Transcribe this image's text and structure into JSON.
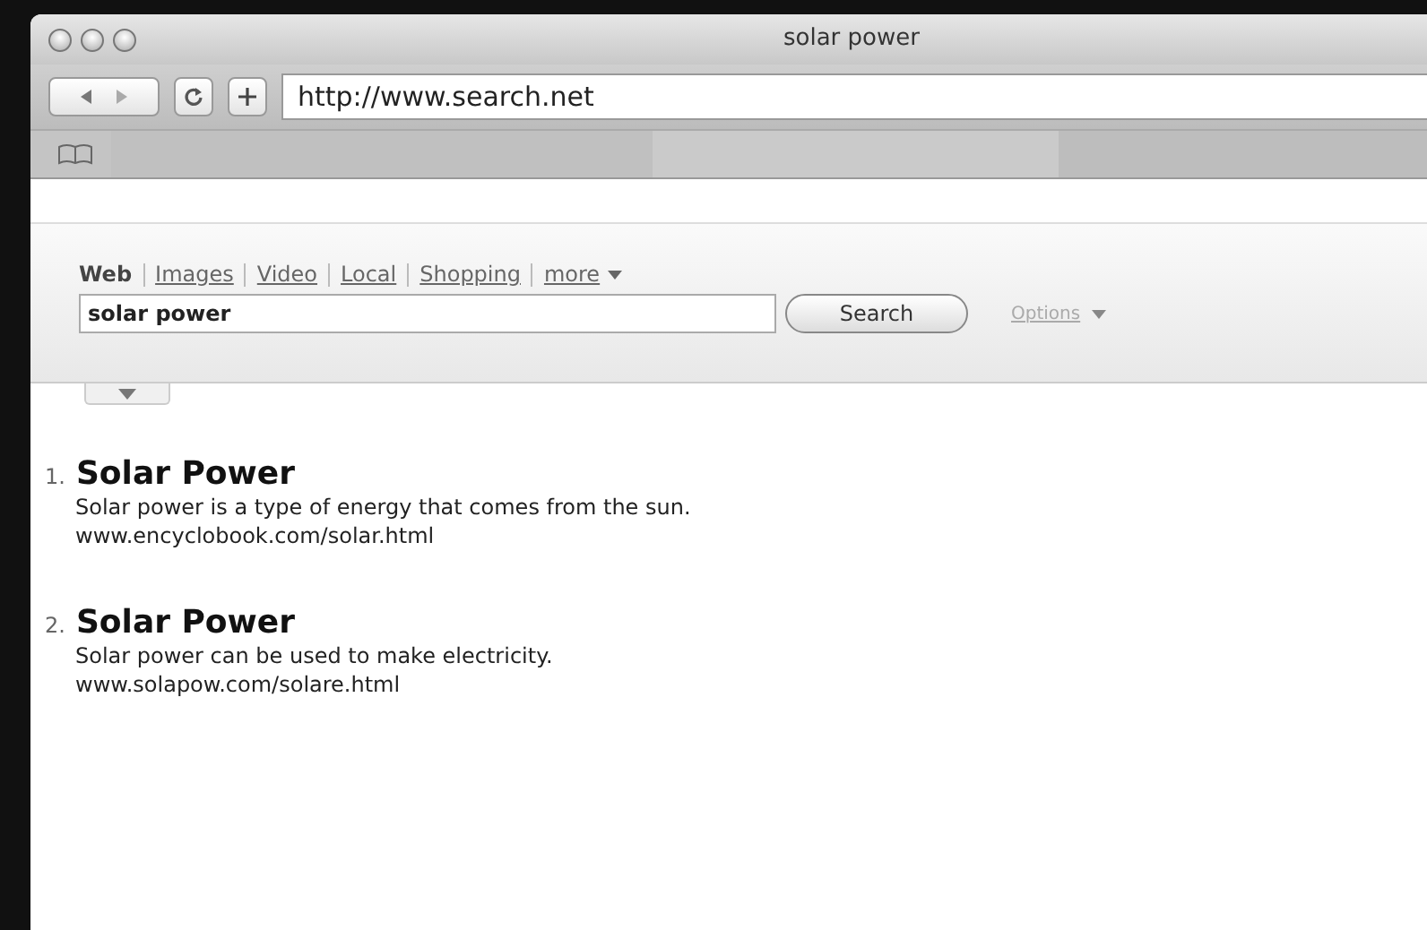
{
  "window": {
    "title": "solar power"
  },
  "toolbar": {
    "address": "http://www.search.net"
  },
  "search_tabs": [
    {
      "label": "Web",
      "selected": true
    },
    {
      "label": "Images",
      "selected": false
    },
    {
      "label": "Video",
      "selected": false
    },
    {
      "label": "Local",
      "selected": false
    },
    {
      "label": "Shopping",
      "selected": false
    },
    {
      "label": "more",
      "selected": false
    }
  ],
  "search": {
    "value": "solar power",
    "button": "Search",
    "options": "Options"
  },
  "results": [
    {
      "number": "1.",
      "title": "Solar Power",
      "snippet": "Solar power is a type of energy that comes from the sun.",
      "url": "www.encyclobook.com/solar.html"
    },
    {
      "number": "2.",
      "title": "Solar Power",
      "snippet": "Solar power can be used to make electricity.",
      "url": "www.solapow.com/solare.html"
    }
  ]
}
